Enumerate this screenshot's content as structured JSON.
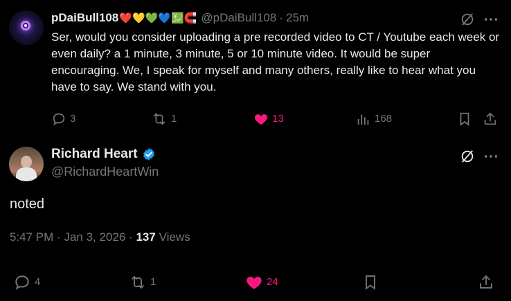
{
  "reply": {
    "display_name": "pDaiBull108",
    "name_emojis": "❤️💛💚💙💹🧲",
    "handle": "@pDaiBull108",
    "separator": "·",
    "time": "25m",
    "text": "Ser, would you consider uploading a pre recorded video to CT / Youtube each week or even daily? a 1 minute, 3 minute, 5 or 10 minute video. It would be super encouraging. We, I speak for myself and many others, really like to hear what you have to say. We stand with you.",
    "actions": {
      "replies": "3",
      "reposts": "1",
      "likes": "13",
      "views": "168"
    },
    "like_color": "#f91880"
  },
  "main": {
    "display_name": "Richard Heart",
    "handle": "@RichardHeartWin",
    "text": "noted",
    "time": "5:47 PM",
    "dot1": "·",
    "date": "Jan 3, 2026",
    "dot2": "·",
    "views_count": "137",
    "views_label": "Views",
    "actions": {
      "replies": "4",
      "reposts": "1",
      "likes": "24"
    },
    "verified_color": "#1d9bf0"
  }
}
